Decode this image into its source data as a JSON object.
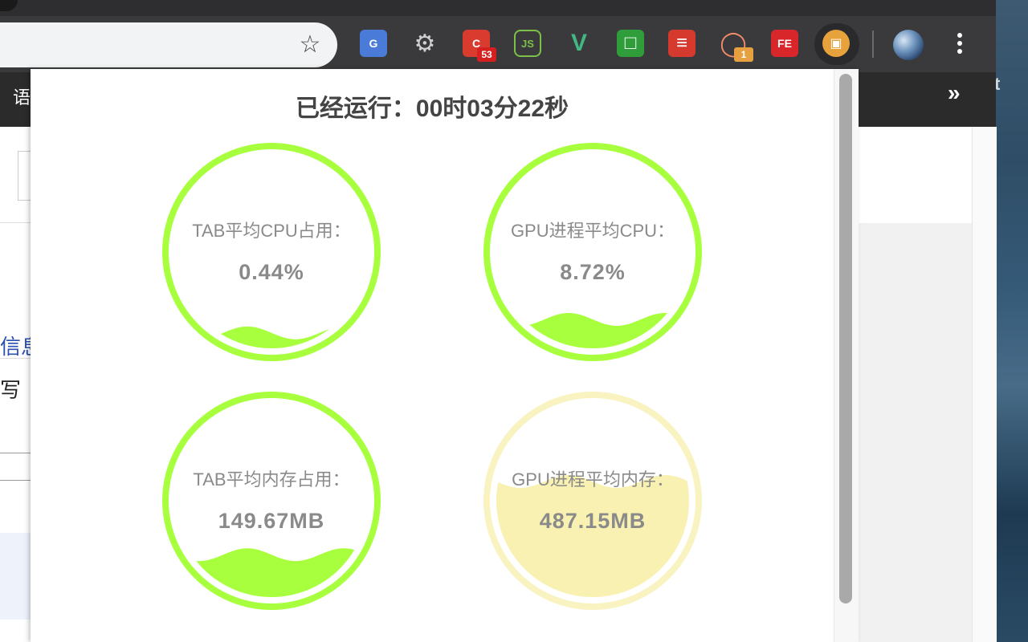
{
  "browser": {
    "extensions": [
      {
        "name": "google-translate-icon",
        "bg": "#4a7bd8",
        "text": "G"
      },
      {
        "name": "gear-icon",
        "bg": "transparent",
        "text": "⚙"
      },
      {
        "name": "c-extension-icon",
        "bg": "#d93b2f",
        "text": "C",
        "badge": "53",
        "badge_color": "#d42020"
      },
      {
        "name": "nodejs-icon",
        "bg": "transparent",
        "text": "JS"
      },
      {
        "name": "vue-devtools-icon",
        "bg": "transparent",
        "text": "V"
      },
      {
        "name": "green-square-icon",
        "bg": "#2e9d3a",
        "text": "□"
      },
      {
        "name": "red-list-icon",
        "bg": "#d63a2e",
        "text": "≡"
      },
      {
        "name": "orange-ring-icon",
        "bg": "transparent",
        "text": "◯",
        "badge": "1",
        "badge_color": "#e6a040"
      },
      {
        "name": "fe-helper-icon",
        "bg": "#d8262a",
        "text": "FE"
      },
      {
        "name": "monitor-extension-icon",
        "bg": "#e8a23c",
        "text": "▣"
      }
    ]
  },
  "page_behind": {
    "nav_text": "语",
    "chevron": "»",
    "link_text": "信息",
    "body_text": "写"
  },
  "desktop": {
    "text": "t"
  },
  "popup": {
    "title": "已经运行：00时03分22秒",
    "gauges": [
      {
        "label": "TAB平均CPU占用：",
        "value": "0.44%",
        "fill_fraction": 0.08,
        "ring_color": "#a8ff3e",
        "fill_color": "#a8ff3e"
      },
      {
        "label": "GPU进程平均CPU：",
        "value": "8.72%",
        "fill_fraction": 0.15,
        "ring_color": "#a8ff3e",
        "fill_color": "#a8ff3e"
      },
      {
        "label": "TAB平均内存占用：",
        "value": "149.67MB",
        "fill_fraction": 0.22,
        "ring_color": "#a8ff3e",
        "fill_color": "#a8ff3e"
      },
      {
        "label": "GPU进程平均内存：",
        "value": "487.15MB",
        "fill_fraction": 0.6,
        "ring_color": "#f8f3c0",
        "fill_color": "#f8f1b2"
      }
    ]
  }
}
